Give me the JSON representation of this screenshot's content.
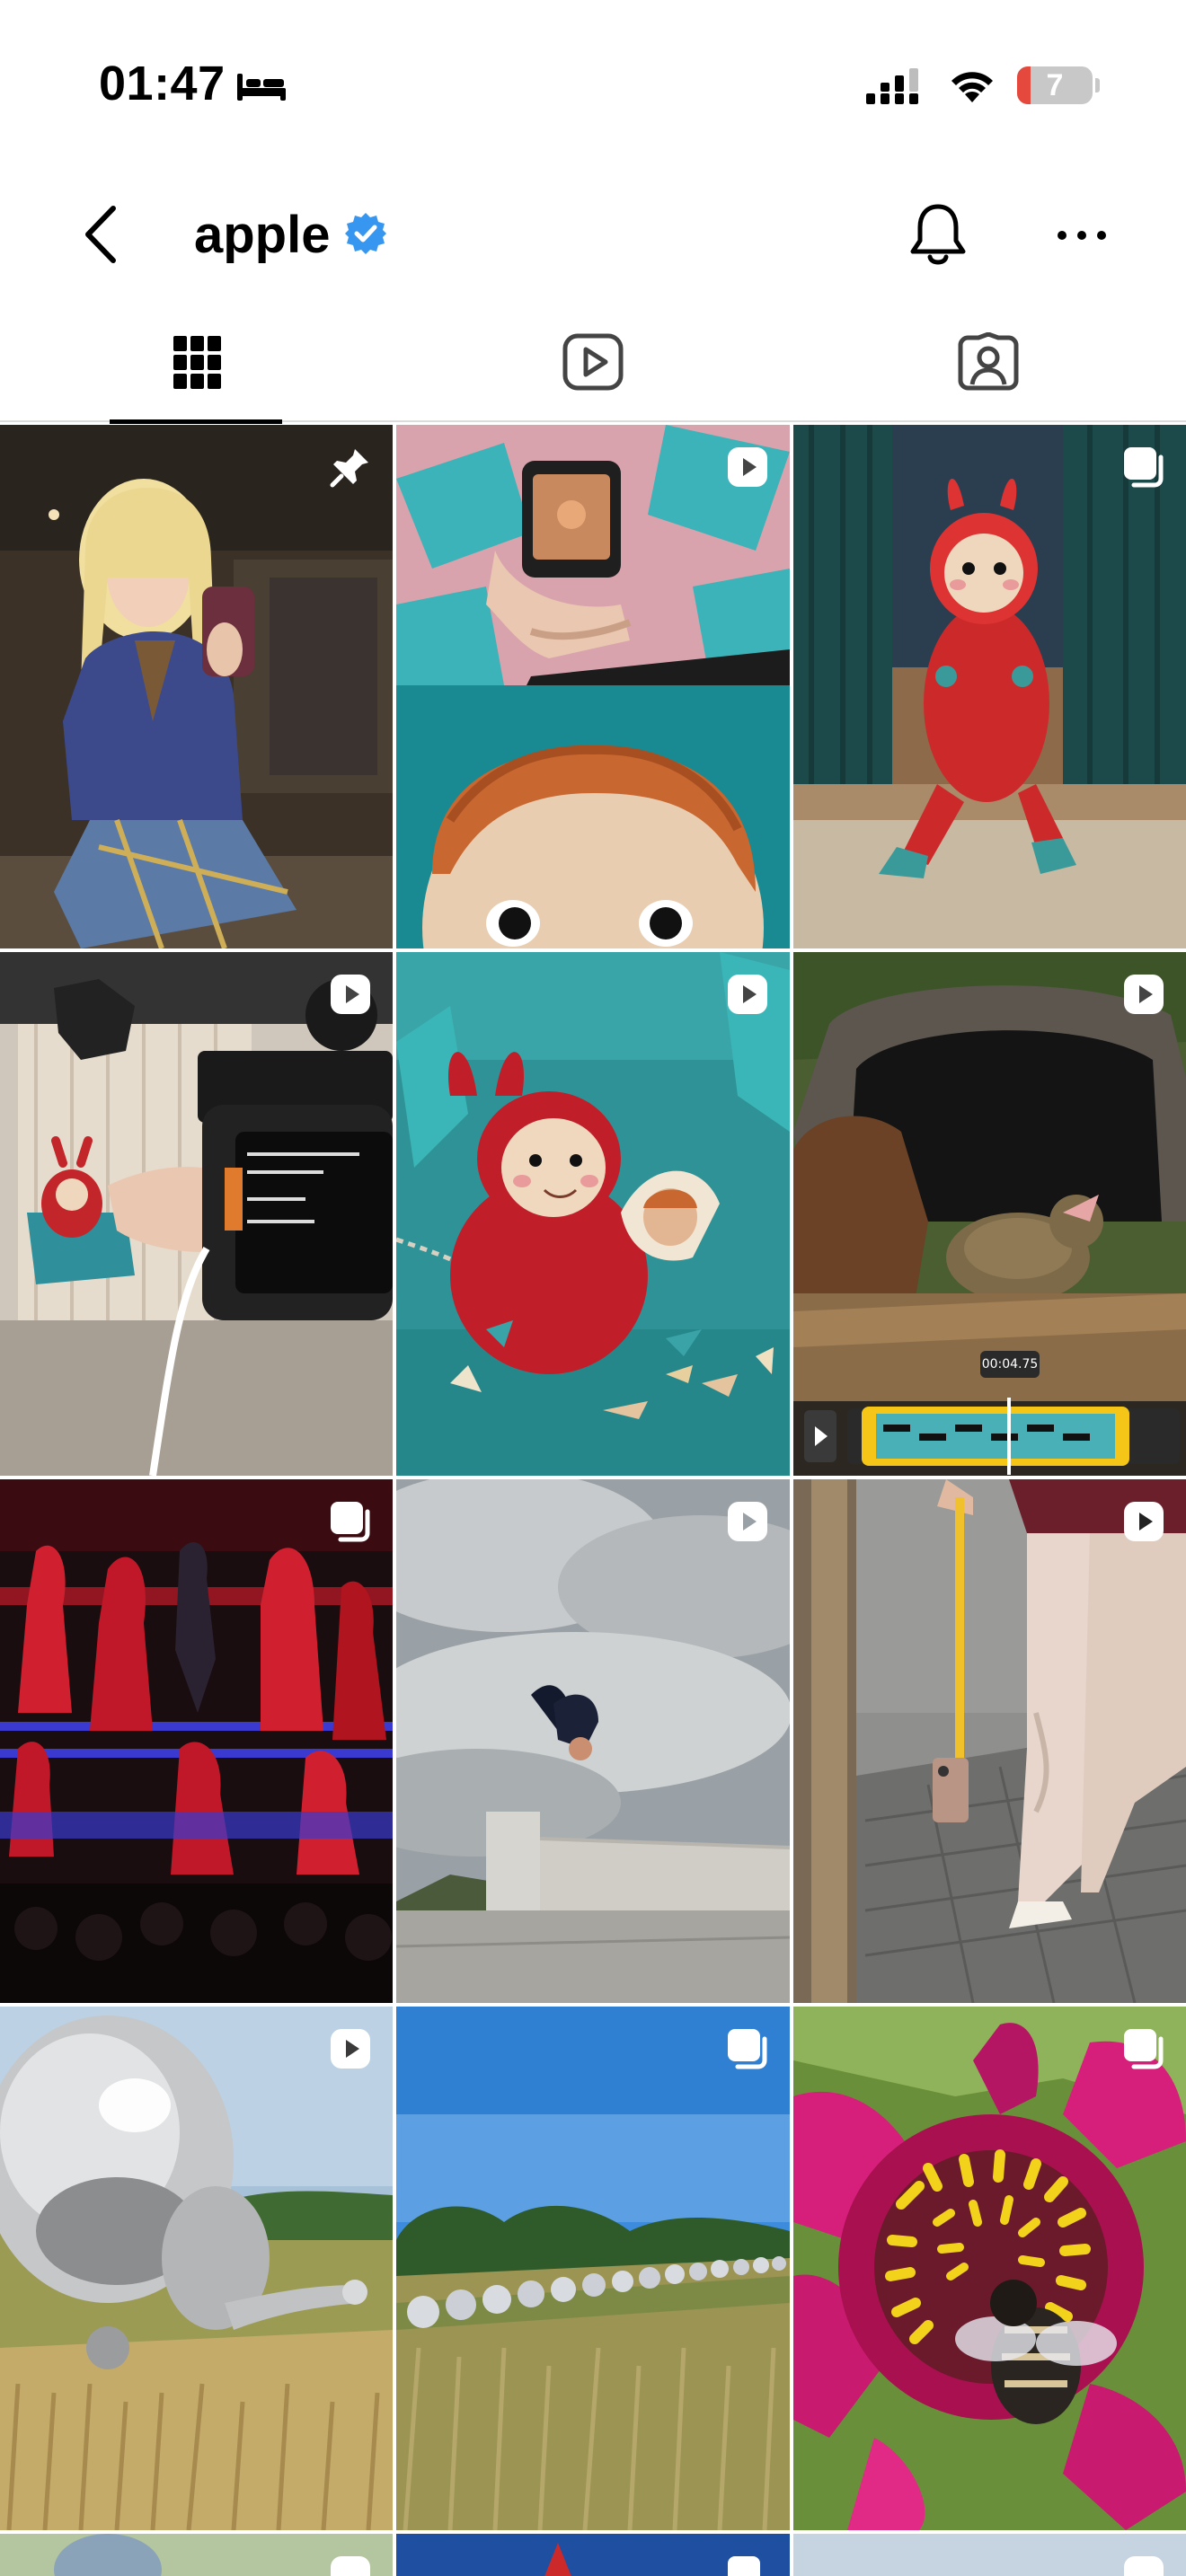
{
  "status_bar": {
    "time": "01:47",
    "battery_level": "7",
    "battery_fraction": 0.07,
    "icons": [
      "sleep-bed-icon",
      "cellular-signal-icon",
      "wifi-icon",
      "battery-icon"
    ]
  },
  "header": {
    "username": "apple",
    "verified": true,
    "icons": [
      "back-chevron-icon",
      "verified-badge-icon",
      "notification-bell-icon",
      "more-options-icon"
    ]
  },
  "tabs": [
    {
      "name": "posts-grid",
      "icon": "grid-icon",
      "selected": true
    },
    {
      "name": "reels",
      "icon": "reels-play-icon",
      "selected": false
    },
    {
      "name": "tagged",
      "icon": "tagged-person-icon",
      "selected": false
    }
  ],
  "video_scrubber": {
    "time_label": "00:04.75"
  },
  "colors": {
    "verified_blue": "#3797f0",
    "battery_low_red": "#e5483c",
    "scrubber_yellow": "#f5c518"
  },
  "posts": [
    {
      "id": "post-1",
      "type": "pinned",
      "overlay_icon": "pin-icon",
      "subject": "woman taking mirror selfie"
    },
    {
      "id": "post-2",
      "type": "reel",
      "overlay_icon": "reel-icon",
      "subject": "phone rig and felt puppet face"
    },
    {
      "id": "post-3",
      "type": "carousel",
      "overlay_icon": "carousel-icon",
      "subject": "red sequin felt creature"
    },
    {
      "id": "post-4",
      "type": "reel",
      "overlay_icon": "reel-icon",
      "subject": "behind the scenes filming puppet"
    },
    {
      "id": "post-5",
      "type": "reel",
      "overlay_icon": "reel-icon",
      "subject": "felt creature with seashells"
    },
    {
      "id": "post-6",
      "type": "reel",
      "overlay_icon": "reel-icon",
      "subject": "tortoise in shelter with video editor"
    },
    {
      "id": "post-7",
      "type": "carousel",
      "overlay_icon": "carousel-icon",
      "subject": "red stage performance"
    },
    {
      "id": "post-8",
      "type": "reel",
      "overlay_icon": "reel-icon",
      "subject": "backflip against cloudy sky"
    },
    {
      "id": "post-9",
      "type": "reel",
      "overlay_icon": "reel-icon",
      "subject": "phone on measuring tape"
    },
    {
      "id": "post-10",
      "type": "reel",
      "overlay_icon": "reel-icon",
      "subject": "silver balloon in meadow"
    },
    {
      "id": "post-11",
      "type": "carousel",
      "overlay_icon": "carousel-icon",
      "subject": "chrome spheres across field"
    },
    {
      "id": "post-12",
      "type": "carousel",
      "overlay_icon": "carousel-icon",
      "subject": "bee on pink dahlia"
    },
    {
      "id": "post-13",
      "type": "reel",
      "overlay_icon": "reel-icon",
      "subject": "partial row"
    },
    {
      "id": "post-14",
      "type": "carousel",
      "overlay_icon": "carousel-icon",
      "subject": "partial row"
    },
    {
      "id": "post-15",
      "type": "reel",
      "overlay_icon": "reel-icon",
      "subject": "partial row"
    }
  ]
}
